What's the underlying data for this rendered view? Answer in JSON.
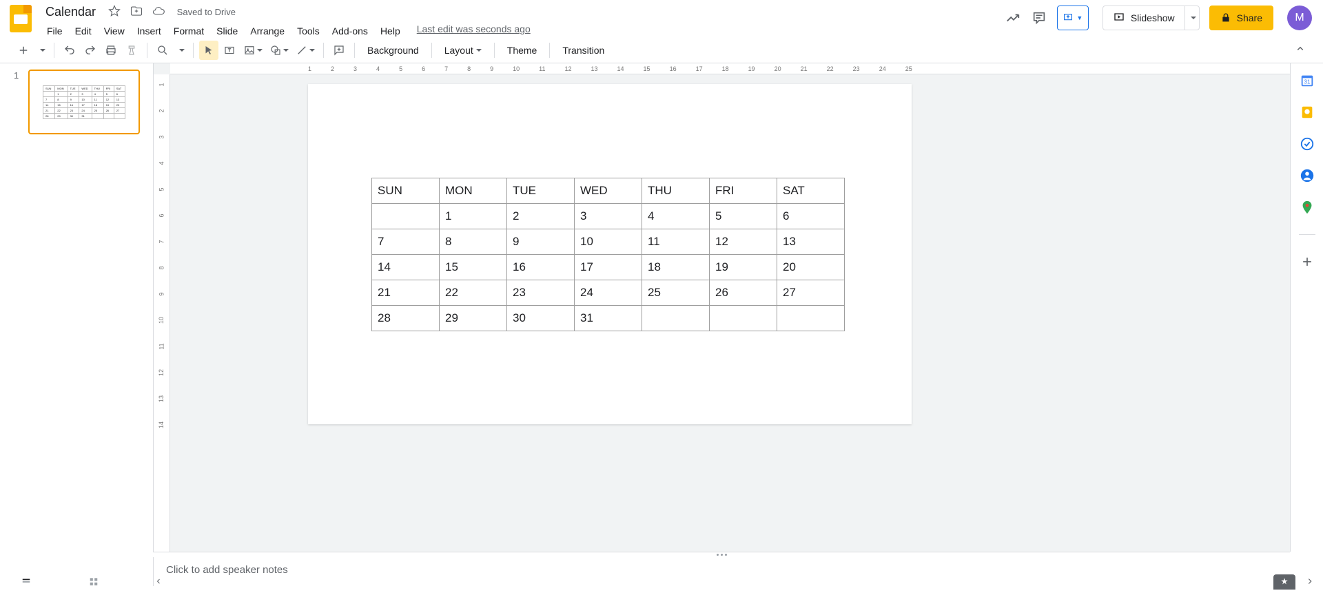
{
  "doc": {
    "title": "Calendar",
    "saved_status": "Saved to Drive"
  },
  "menu": {
    "file": "File",
    "edit": "Edit",
    "view": "View",
    "insert": "Insert",
    "format": "Format",
    "slide": "Slide",
    "arrange": "Arrange",
    "tools": "Tools",
    "addons": "Add-ons",
    "help": "Help",
    "last_edit": "Last edit was seconds ago"
  },
  "header_buttons": {
    "slideshow": "Slideshow",
    "share": "Share",
    "avatar_initial": "M"
  },
  "toolbar": {
    "background": "Background",
    "layout": "Layout",
    "theme": "Theme",
    "transition": "Transition"
  },
  "ruler_h": [
    "1",
    "2",
    "3",
    "4",
    "5",
    "6",
    "7",
    "8",
    "9",
    "10",
    "11",
    "12",
    "13",
    "14",
    "15",
    "16",
    "17",
    "18",
    "19",
    "20",
    "21",
    "22",
    "23",
    "24",
    "25"
  ],
  "ruler_v": [
    "1",
    "2",
    "3",
    "4",
    "5",
    "6",
    "7",
    "8",
    "9",
    "10",
    "11",
    "12",
    "13",
    "14"
  ],
  "filmstrip": {
    "slide_num": "1"
  },
  "calendar": {
    "headers": [
      "SUN",
      "MON",
      "TUE",
      "WED",
      "THU",
      "FRI",
      "SAT"
    ],
    "rows": [
      [
        "",
        "1",
        "2",
        "3",
        "4",
        "5",
        "6"
      ],
      [
        "7",
        "8",
        "9",
        "10",
        "11",
        "12",
        "13"
      ],
      [
        "14",
        "15",
        "16",
        "17",
        "18",
        "19",
        "20"
      ],
      [
        "21",
        "22",
        "23",
        "24",
        "25",
        "26",
        "27"
      ],
      [
        "28",
        "29",
        "30",
        "31",
        "",
        "",
        ""
      ]
    ]
  },
  "notes": {
    "placeholder": "Click to add speaker notes"
  }
}
